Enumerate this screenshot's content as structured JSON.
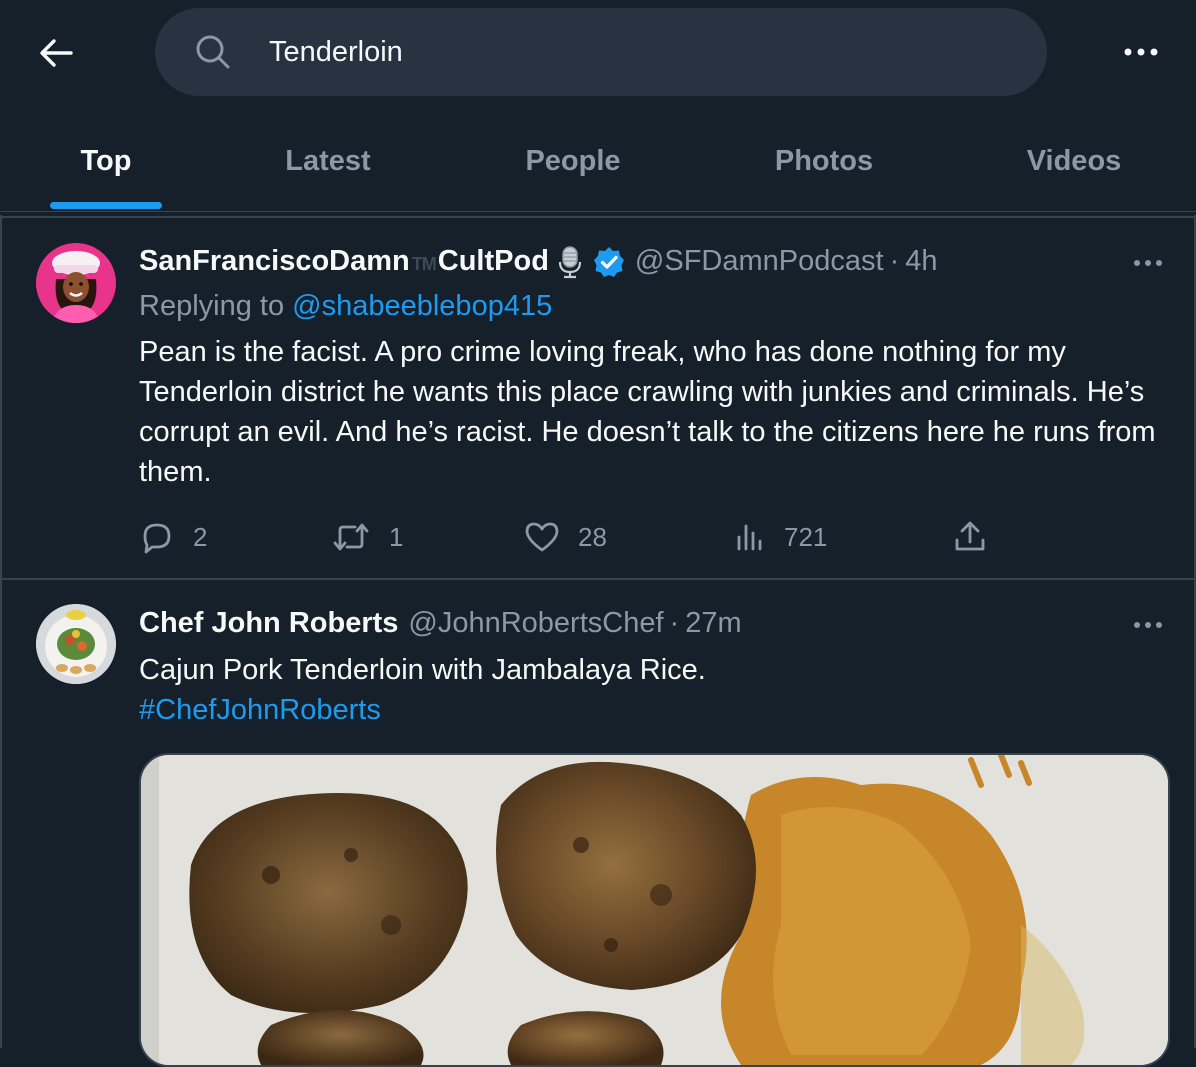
{
  "header": {
    "back_icon": "arrow-left-icon",
    "search": {
      "value": "Tenderloin",
      "icon": "search-icon"
    },
    "more_icon": "more-horizontal-icon",
    "tabs": [
      {
        "label": "Top",
        "active": true
      },
      {
        "label": "Latest",
        "active": false
      },
      {
        "label": "People",
        "active": false
      },
      {
        "label": "Photos",
        "active": false
      },
      {
        "label": "Videos",
        "active": false
      }
    ]
  },
  "colors": {
    "background": "#15202b",
    "accent": "#1d9bf0",
    "muted": "#8b98a5",
    "border": "#38444d"
  },
  "tweets": [
    {
      "name_part1": "SanFranciscoDamn",
      "tm": "TM",
      "name_part2": "CultPod",
      "name_emoji": "microphone-icon",
      "verified": true,
      "handle": "@SFDamnPodcast",
      "sep": "·",
      "time": "4h",
      "replying_prefix": "Replying to",
      "replying_to": "@shabeeblebop415",
      "text": "Pean is the facist. A pro crime loving freak, who has done nothing for my Tenderloin district he wants this place crawling with junkies and criminals. He’s corrupt an evil. And he’s racist. He doesn’t talk to the citizens here he runs from them.",
      "stats": {
        "replies": "2",
        "retweets": "1",
        "likes": "28",
        "views": "721"
      }
    },
    {
      "name": "Chef John Roberts",
      "handle": "@JohnRobertsChef",
      "sep": "·",
      "time": "27m",
      "text": "Cajun Pork Tenderloin with Jambalaya Rice.",
      "hashtag": "#ChefJohnRoberts",
      "media": "photo of seared pork tenderloin medallions with jambalaya rice"
    }
  ]
}
